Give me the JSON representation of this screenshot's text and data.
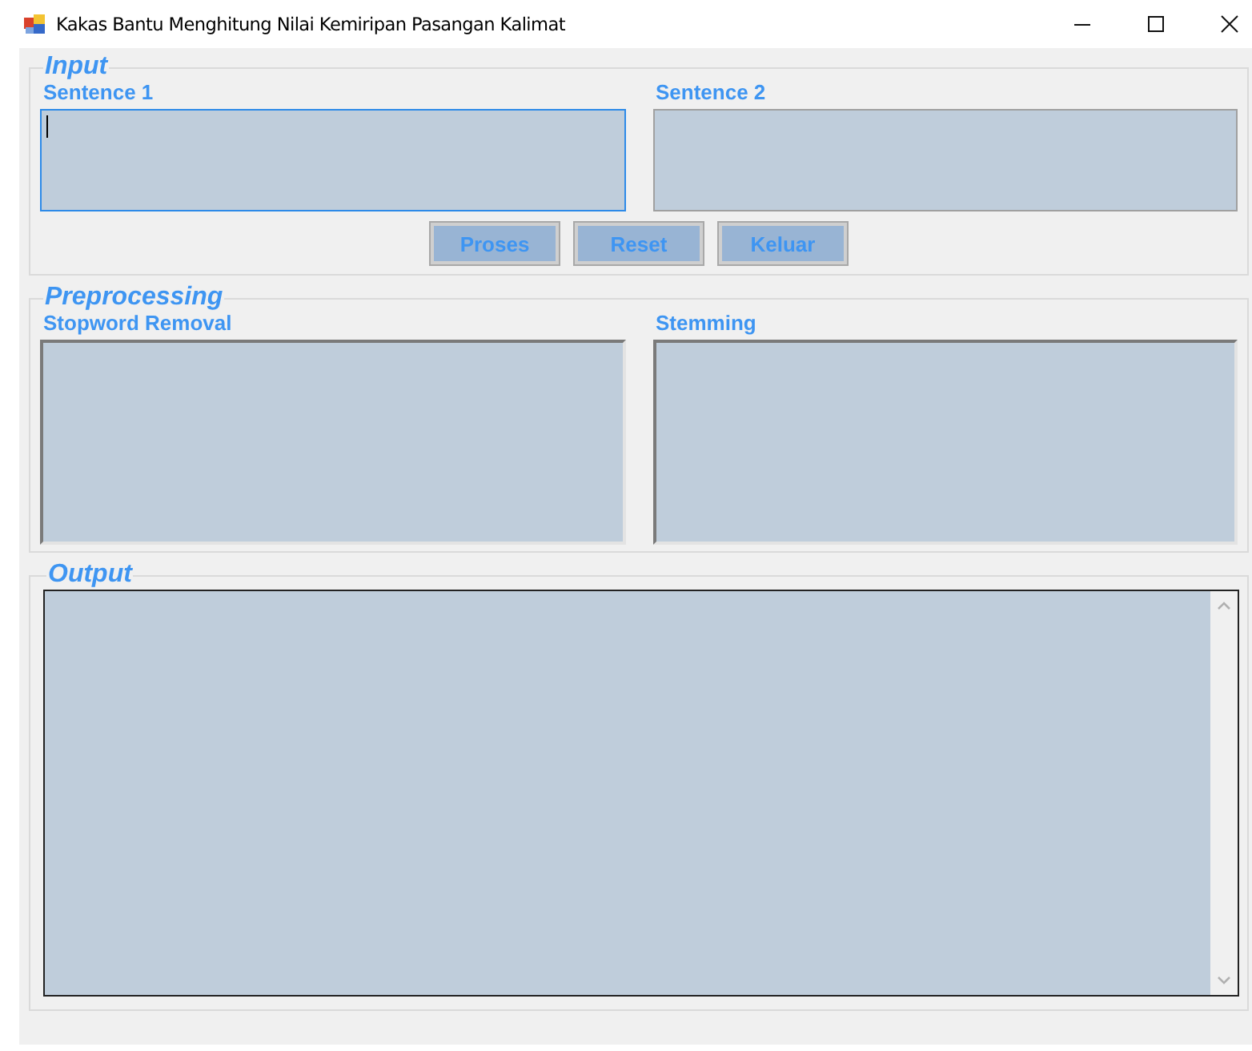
{
  "window": {
    "title": "Kakas Bantu Menghitung Nilai Kemiripan Pasangan Kalimat"
  },
  "input": {
    "legend": "Input",
    "fields": [
      {
        "label": "Sentence 1",
        "focused": true
      },
      {
        "label": "Sentence 2",
        "focused": false
      }
    ],
    "buttons": [
      "Proses",
      "Reset",
      "Keluar"
    ]
  },
  "preprocessing": {
    "legend": "Preprocessing",
    "fields": [
      {
        "label": "Stopword Removal"
      },
      {
        "label": "Stemming"
      }
    ]
  },
  "output": {
    "legend": "Output"
  }
}
